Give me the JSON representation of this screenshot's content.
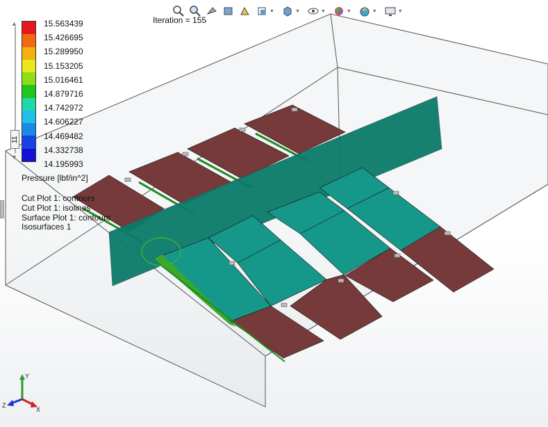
{
  "toolbar": {
    "icons": [
      "zoom-to-fit-icon",
      "zoom-to-area-icon",
      "previous-view-icon",
      "section-view-icon",
      "dynamic-annotation-icon",
      "view-orientation-icon",
      "display-style-icon",
      "hide-show-items-icon",
      "edit-appearance-icon",
      "apply-scene-icon",
      "view-settings-icon"
    ]
  },
  "iteration_label": "Iteration = 155",
  "legend": {
    "values": [
      "15.563439",
      "15.426695",
      "15.289950",
      "15.153205",
      "15.016461",
      "14.879716",
      "14.742972",
      "14.606227",
      "14.469482",
      "14.332738",
      "14.195993"
    ],
    "colors": [
      "#e8171d",
      "#f06a12",
      "#f2b10e",
      "#e9e61a",
      "#8fdc18",
      "#22c51f",
      "#1fd9a8",
      "#1fc1e6",
      "#1a8ae4",
      "#1743e3",
      "#1511d8"
    ],
    "slider_value": "11",
    "units": "Pressure [lbf/in^2]"
  },
  "plots": [
    "Cut Plot 1: contours",
    "Cut Plot 1: isolines",
    "Surface Plot 1: contours",
    "Isosurfaces 1"
  ],
  "colors": {
    "panel": "#753a39",
    "cutplane": "#0b7a6a",
    "teal_panel": "#15988a",
    "green_edge": "#1f8a1a"
  },
  "axes": {
    "x": "X",
    "y": "Y",
    "z": "Z"
  }
}
